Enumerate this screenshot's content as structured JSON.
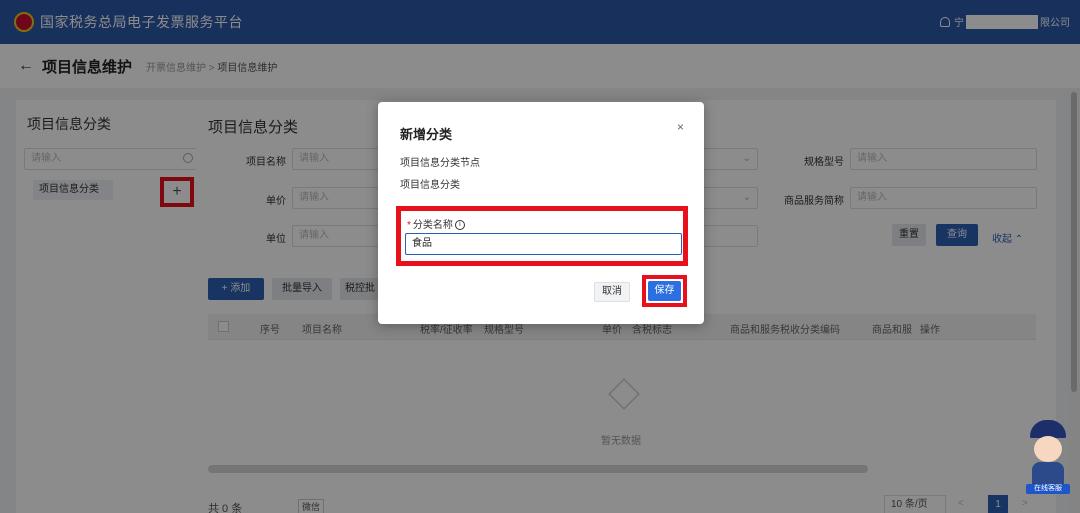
{
  "header": {
    "title": "国家税务总局电子发票服务平台",
    "user_prefix": "宁",
    "user_suffix": "限公司"
  },
  "breadcrumb": {
    "back": "←",
    "title": "项目信息维护",
    "parent": "开票信息维护",
    "separator": ">",
    "current": "项目信息维护"
  },
  "left_panel": {
    "title": "项目信息分类",
    "search_placeholder": "请输入",
    "tree_node": "项目信息分类",
    "add_label": "+"
  },
  "main_panel": {
    "title": "项目信息分类",
    "fields": {
      "name_label": "项目名称",
      "name_placeholder": "请输入",
      "spec_label": "规格型号",
      "spec_placeholder": "请输入",
      "price_label": "单价",
      "price_placeholder": "请输入",
      "short_label": "商品服务简称",
      "short_placeholder": "请输入",
      "unit_label": "单位",
      "unit_placeholder": "请输入"
    },
    "buttons": {
      "reset": "重置",
      "query": "查询",
      "collapse": "收起 ⌃",
      "add": "+ 添加",
      "batch_import": "批量导入",
      "tax_batch": "税控批"
    },
    "table_headers": [
      "序号",
      "项目名称",
      "税率/征收率",
      "规格型号",
      "单价",
      "含税标志",
      "商品和服务税收分类编码",
      "商品和服",
      "操作"
    ],
    "empty_text": "暂无数据",
    "total": "共 0 条",
    "page_size": "10 条/页",
    "current_page": "1",
    "prev": "<",
    "next": ">",
    "wechat": "微信"
  },
  "dialog": {
    "title": "新增分类",
    "close": "×",
    "node_label": "项目信息分类节点",
    "node_value": "项目信息分类",
    "field_required": "*",
    "field_label": "分类名称",
    "field_info": "i",
    "field_value": "食品",
    "cancel": "取消",
    "save": "保存"
  },
  "mascot": {
    "tag": "在线客服"
  },
  "colors": {
    "header_bg": "#2b5aa8",
    "primary": "#2b5fb4",
    "highlight": "#e8101b"
  }
}
